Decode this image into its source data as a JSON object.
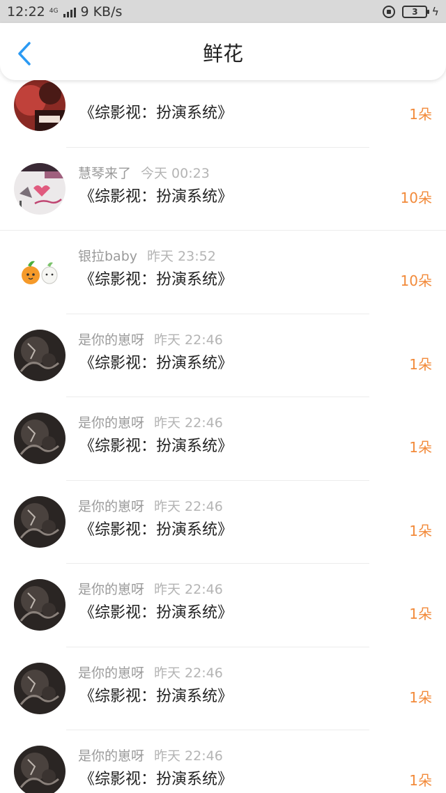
{
  "status_bar": {
    "time": "12:22",
    "network": "4G",
    "speed": "9 KB/s",
    "battery": "3"
  },
  "header": {
    "title": "鲜花",
    "back_icon": "chevron-left-icon"
  },
  "colors": {
    "accent": "#2b9af3",
    "count": "#f28a3a",
    "meta": "#9a9a9a"
  },
  "items": [
    {
      "name": "",
      "time": "",
      "book": "《综影视：扮演系统》",
      "count": "1朵",
      "avatar": "avatar-photo-red"
    },
    {
      "name": "慧琴来了",
      "time": "今天 00:23",
      "book": "《综影视：扮演系统》",
      "count": "10朵",
      "avatar": "avatar-love-text"
    },
    {
      "name": "银拉baby",
      "time": "昨天 23:52",
      "book": "《综影视：扮演系统》",
      "count": "10朵",
      "avatar": "avatar-orange-cartoon"
    },
    {
      "name": "是你的崽呀",
      "time": "昨天 22:46",
      "book": "《综影视：扮演系统》",
      "count": "1朵",
      "avatar": "avatar-dark-photo"
    },
    {
      "name": "是你的崽呀",
      "time": "昨天 22:46",
      "book": "《综影视：扮演系统》",
      "count": "1朵",
      "avatar": "avatar-dark-photo"
    },
    {
      "name": "是你的崽呀",
      "time": "昨天 22:46",
      "book": "《综影视：扮演系统》",
      "count": "1朵",
      "avatar": "avatar-dark-photo"
    },
    {
      "name": "是你的崽呀",
      "time": "昨天 22:46",
      "book": "《综影视：扮演系统》",
      "count": "1朵",
      "avatar": "avatar-dark-photo"
    },
    {
      "name": "是你的崽呀",
      "time": "昨天 22:46",
      "book": "《综影视：扮演系统》",
      "count": "1朵",
      "avatar": "avatar-dark-photo"
    },
    {
      "name": "是你的崽呀",
      "time": "昨天 22:46",
      "book": "《综影视：扮演系统》",
      "count": "1朵",
      "avatar": "avatar-dark-photo"
    }
  ]
}
